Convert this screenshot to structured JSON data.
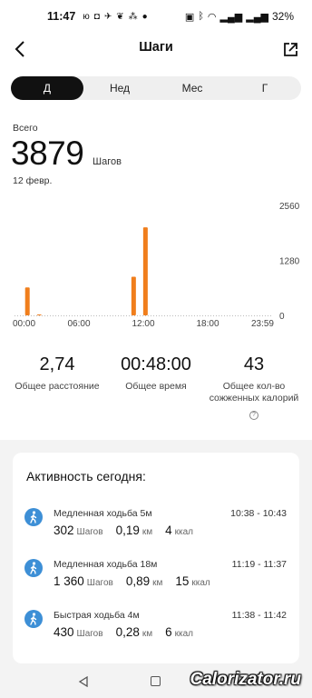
{
  "status_bar": {
    "time": "11:47",
    "battery": "32%"
  },
  "header": {
    "title": "Шаги"
  },
  "tabs": [
    {
      "label": "Д",
      "active": true
    },
    {
      "label": "Нед",
      "active": false
    },
    {
      "label": "Мес",
      "active": false
    },
    {
      "label": "Г",
      "active": false
    }
  ],
  "summary": {
    "total_label": "Всего",
    "total_value": "3879",
    "total_unit": "Шагов",
    "date": "12 февр."
  },
  "chart_data": {
    "type": "bar",
    "x_ticks": [
      "00:00",
      "06:00",
      "12:00",
      "18:00",
      "23:59"
    ],
    "y_ticks": [
      "2560",
      "1280",
      "0"
    ],
    "ylim": [
      0,
      2560
    ],
    "xlim_hours": [
      0,
      24
    ],
    "bar_color": "#f07e1c",
    "bars": [
      {
        "hour": 1.2,
        "value": 650
      },
      {
        "hour": 2.3,
        "value": 20
      },
      {
        "hour": 11.1,
        "value": 900
      },
      {
        "hour": 12.2,
        "value": 2050
      }
    ]
  },
  "stats": [
    {
      "value": "2,74",
      "label": "Общее расстояние"
    },
    {
      "value": "00:48:00",
      "label": "Общее время"
    },
    {
      "value": "43",
      "label": "Общее кол-во сожженных калорий"
    }
  ],
  "activity": {
    "title": "Активность сегодня:",
    "items": [
      {
        "name": "Медленная ходьба 5м",
        "time": "10:38 - 10:43",
        "steps": "302",
        "steps_unit": "Шагов",
        "km": "0,19",
        "km_unit": "км",
        "kcal": "4",
        "kcal_unit": "ккал"
      },
      {
        "name": "Медленная ходьба 18м",
        "time": "11:19 - 11:37",
        "steps": "1 360",
        "steps_unit": "Шагов",
        "km": "0,89",
        "km_unit": "км",
        "kcal": "15",
        "kcal_unit": "ккал"
      },
      {
        "name": "Быстрая ходьба 4м",
        "time": "11:38 - 11:42",
        "steps": "430",
        "steps_unit": "Шагов",
        "km": "0,28",
        "km_unit": "км",
        "kcal": "6",
        "kcal_unit": "ккал"
      }
    ]
  },
  "watermark": "Calorizator.ru",
  "colors": {
    "accent": "#f07e1c",
    "activity_icon": "#3d8fd6"
  }
}
